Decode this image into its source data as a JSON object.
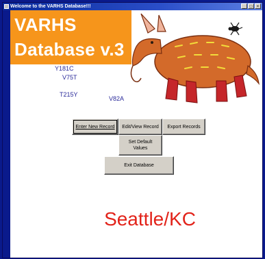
{
  "window": {
    "title": "Welcome to the VARHS Database!!!",
    "controls": [
      "_",
      "□",
      "×"
    ]
  },
  "banner": {
    "line1": "VARHS",
    "line2": "Database v.3",
    "background_color": "#f6951b"
  },
  "mutations": [
    "Y181C",
    "V75T",
    "T215Y",
    "V82A"
  ],
  "buttons": {
    "enter_new_record": "Enter New Record",
    "edit_view_record": "Edit/View Record",
    "export_records": "Export Records",
    "set_default_values_line1": "Set Default",
    "set_default_values_line2": "Values",
    "exit_database": "Exit Database"
  },
  "footer": {
    "location": "Seattle/KC",
    "color": "#e2231a"
  },
  "icons": [
    "armadillo-illustration",
    "bug-icon"
  ]
}
